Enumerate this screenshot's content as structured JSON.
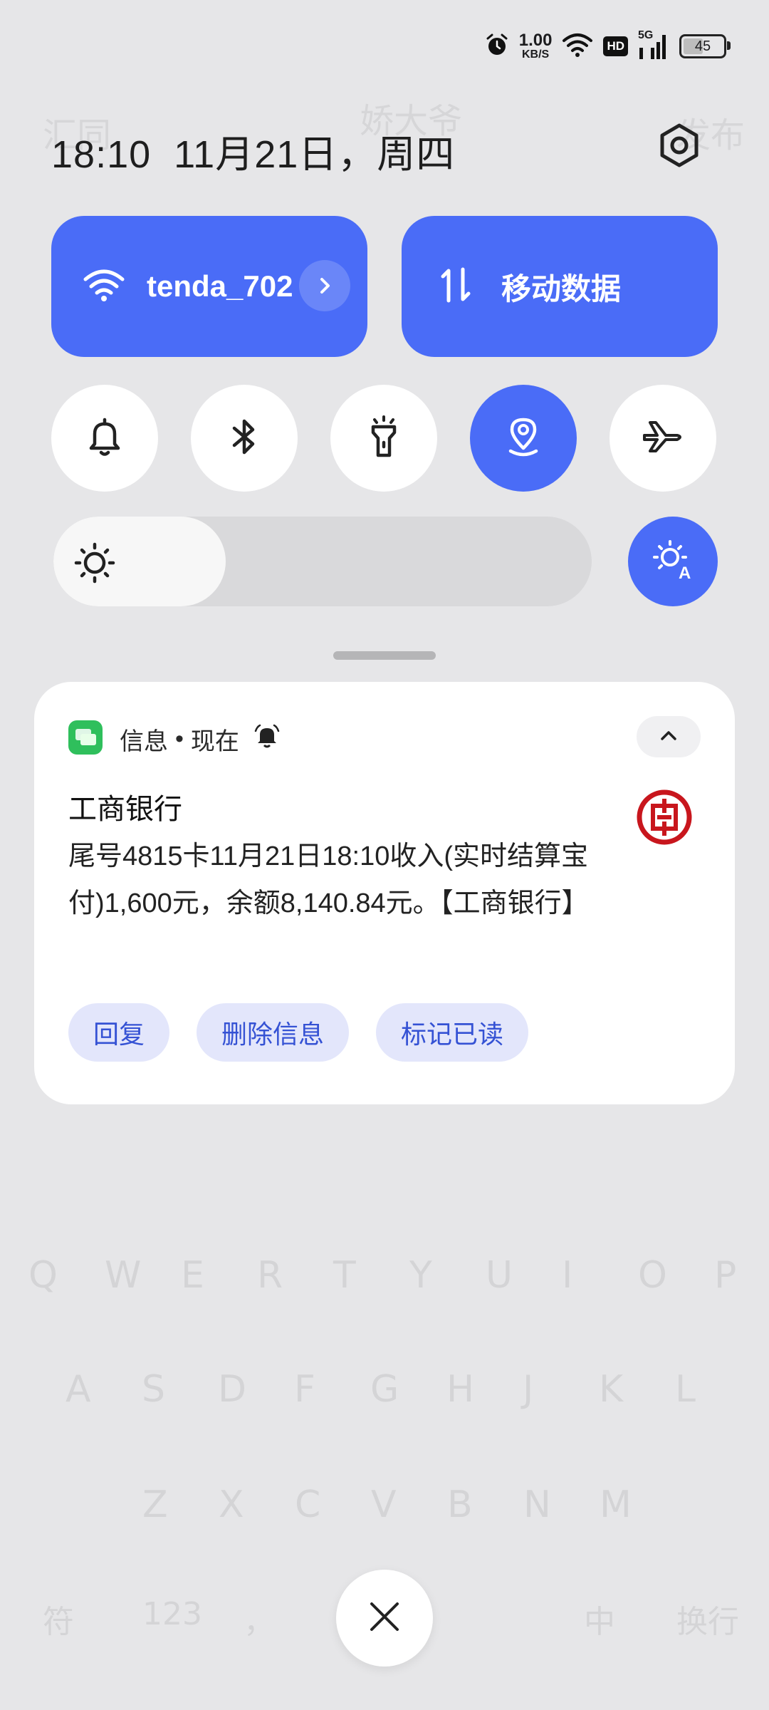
{
  "status_bar": {
    "speed_value": "1.00",
    "speed_unit": "KB/S",
    "hd_label": "HD",
    "network_label": "5G",
    "battery_level": "45",
    "icons": [
      "alarm-icon",
      "wifi-icon",
      "signal-icon",
      "battery-icon"
    ]
  },
  "header": {
    "time": "18:10",
    "date": "11月21日，周四"
  },
  "tiles": {
    "wifi_label": "tenda_702",
    "mobile_data_label": "移动数据"
  },
  "toggles": [
    {
      "name": "bell",
      "on": false
    },
    {
      "name": "bluetooth",
      "on": false
    },
    {
      "name": "flashlight",
      "on": false
    },
    {
      "name": "location",
      "on": true
    },
    {
      "name": "airplane",
      "on": false
    }
  ],
  "brightness": {
    "level": 0.32
  },
  "notification": {
    "app_name": "信息",
    "separator": "•",
    "time": "现在",
    "sender": "工商银行",
    "message": "尾号4815卡11月21日18:10收入(实时结算宝付)1,600元，余额8,140.84元。【工商银行】",
    "actions": [
      "回复",
      "删除信息",
      "标记已读"
    ]
  },
  "background_app": {
    "top_left": "汇同",
    "top_center": "娇大爷",
    "top_right": "发布",
    "row1": [
      "Q",
      "W",
      "E",
      "R",
      "T",
      "Y",
      "U",
      "I",
      "O",
      "P"
    ],
    "row2": [
      "A",
      "S",
      "D",
      "F",
      "G",
      "H",
      "J",
      "K",
      "L"
    ],
    "row3": [
      "Z",
      "X",
      "C",
      "V",
      "B",
      "N",
      "M"
    ],
    "bottom": [
      "符",
      "123",
      "，",
      "。",
      "中",
      "换行"
    ]
  },
  "colors": {
    "accent": "#4a6cf7",
    "background": "#e6e6e8",
    "card": "#ffffff",
    "action_bg": "#e3e6fb",
    "action_text": "#3552d4"
  }
}
